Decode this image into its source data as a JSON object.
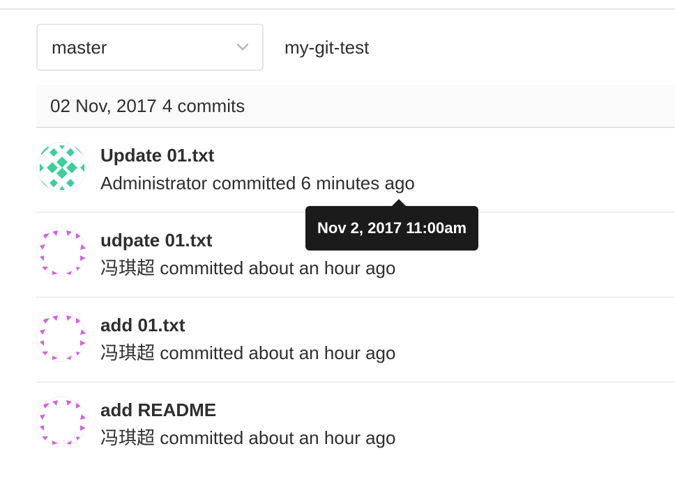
{
  "toolbar": {
    "branch_value": "master",
    "branch_icon": "chevron-down-icon",
    "project_path": "my-git-test"
  },
  "day_group": {
    "date": "02 Nov, 2017",
    "count_label": "4 commits"
  },
  "commits": [
    {
      "title": "Update 01.txt",
      "author": "Administrator",
      "verb": "committed",
      "time": "6 minutes ago",
      "avatar_style": "green-identicon",
      "avatar_color": "#3dcf9a"
    },
    {
      "title": "udpate 01.txt",
      "author": "冯琪超",
      "verb": "committed",
      "time": "about an hour ago",
      "avatar_style": "magenta-identicon",
      "avatar_color": "#d45fe6"
    },
    {
      "title": "add 01.txt",
      "author": "冯琪超",
      "verb": "committed",
      "time": "about an hour ago",
      "avatar_style": "magenta-identicon",
      "avatar_color": "#d45fe6"
    },
    {
      "title": "add README",
      "author": "冯琪超",
      "verb": "committed",
      "time": "about an hour ago",
      "avatar_style": "magenta-identicon",
      "avatar_color": "#d45fe6"
    }
  ],
  "tooltip": {
    "text": "Nov 2, 2017 11:00am"
  },
  "colors": {
    "text": "#2e2e2e",
    "border": "#e5e5e5",
    "header_bg": "#fafafa",
    "tooltip_bg": "#1b1b1b"
  }
}
